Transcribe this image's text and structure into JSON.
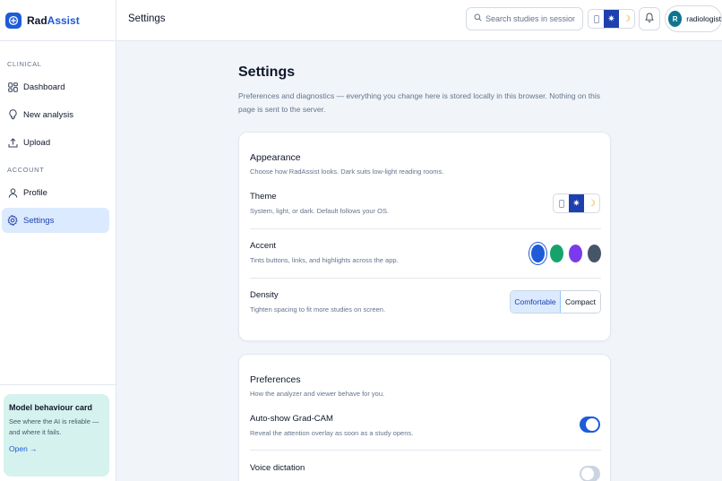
{
  "brand": {
    "name_part1": "Rad",
    "name_part2": "Assist"
  },
  "sidebar": {
    "sections": [
      {
        "label": "CLINICAL",
        "items": [
          {
            "label": "Dashboard",
            "icon": "grid-icon"
          },
          {
            "label": "New analysis",
            "icon": "lightbulb-icon"
          },
          {
            "label": "Upload",
            "icon": "upload-icon"
          }
        ]
      },
      {
        "label": "ACCOUNT",
        "items": [
          {
            "label": "Profile",
            "icon": "user-icon"
          },
          {
            "label": "Settings",
            "icon": "gear-icon",
            "active": true
          }
        ]
      }
    ],
    "model_card": {
      "title": "Model behaviour card",
      "description": "See where the AI is reliable — and where it fails.",
      "link": "Open →"
    }
  },
  "topbar": {
    "title": "Settings",
    "search_placeholder": "Search studies in session...",
    "theme_selected": "light",
    "user": {
      "initial": "R",
      "name": "radiologist"
    }
  },
  "page": {
    "title": "Settings",
    "description": "Preferences and diagnostics — everything you change here is stored locally in this browser. Nothing on this page is sent to the server."
  },
  "appearance": {
    "title": "Appearance",
    "subtitle": "Choose how RadAssist looks. Dark suits low-light reading rooms.",
    "theme": {
      "label": "Theme",
      "desc": "System, light, or dark. Default follows your OS.",
      "selected": "light"
    },
    "accent": {
      "label": "Accent",
      "desc": "Tints buttons, links, and highlights across the app.",
      "colors": [
        "#1e5bd8",
        "#16a36b",
        "#7c3aed",
        "#475569"
      ],
      "selected_index": 0
    },
    "density": {
      "label": "Density",
      "desc": "Tighten spacing to fit more studies on screen.",
      "options": [
        "Comfortable",
        "Compact"
      ],
      "selected": "Comfortable"
    }
  },
  "preferences": {
    "title": "Preferences",
    "subtitle": "How the analyzer and viewer behave for you.",
    "gradcam": {
      "label": "Auto-show Grad-CAM",
      "desc": "Reveal the attention overlay as soon as a study opens.",
      "enabled": true
    },
    "voice": {
      "label": "Voice dictation",
      "enabled": false
    }
  },
  "colors": {
    "accent": "#1e5bd8",
    "active_nav_bg": "#dbeafe",
    "model_card_bg": "#d5f2ee"
  }
}
